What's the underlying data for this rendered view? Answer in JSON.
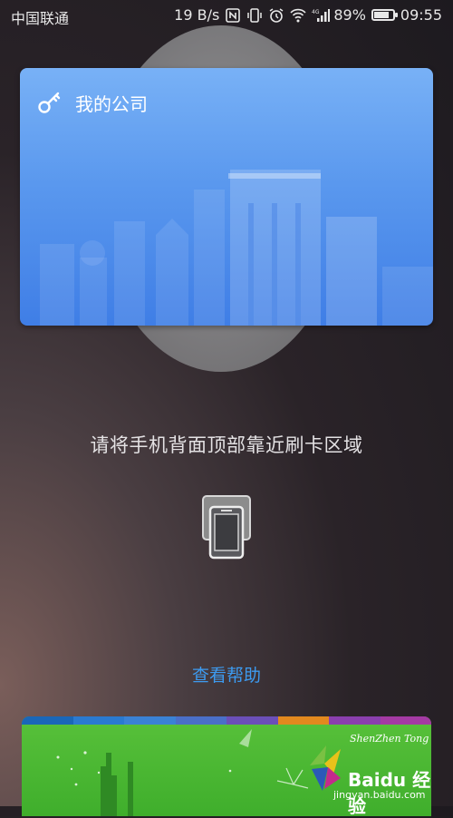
{
  "status_bar": {
    "carrier": "中国联通",
    "speed": "19 B/s",
    "battery_percent": "89%",
    "battery_level": 0.89,
    "time": "09:55",
    "icons": [
      "nfc-icon",
      "vibrate-icon",
      "alarm-icon",
      "wifi-icon",
      "signal-4g-icon",
      "battery-icon"
    ]
  },
  "card": {
    "title": "我的公司",
    "icon": "key-icon",
    "color_top": "#78b1f6",
    "color_bottom": "#3f7ee6"
  },
  "instruction": "请将手机背面顶部靠近刷卡区域",
  "phone_icon": "phone-nfc-icon",
  "help_link": "查看帮助",
  "bottom_card": {
    "color": "#4bb833"
  },
  "watermark": {
    "brand_line1": "ShenZhen Tong",
    "brand_line2": "Baidu 经验",
    "url": "jingyan.baidu.com"
  }
}
